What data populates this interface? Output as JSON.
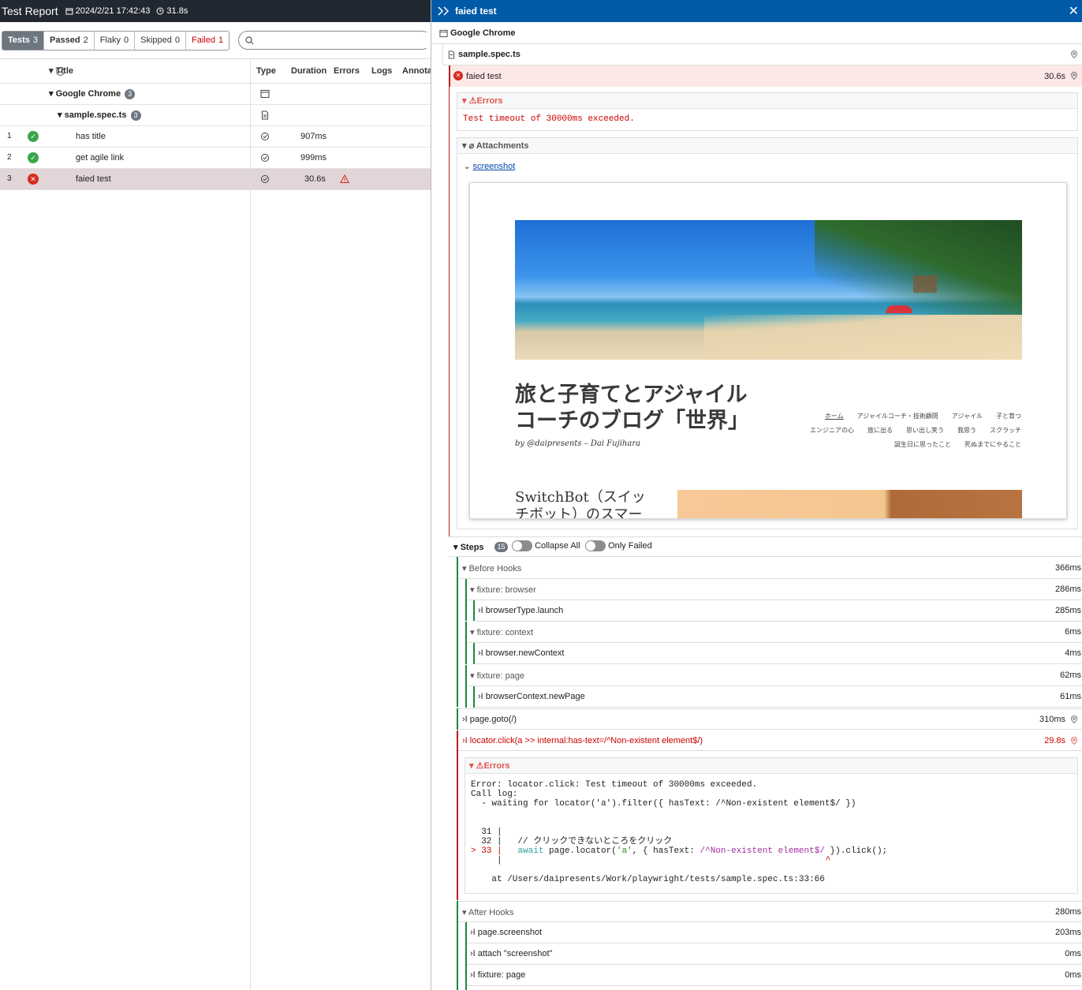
{
  "app": {
    "title": "Test Report",
    "date": "2024/2/21 17:42:43",
    "duration": "31.8s"
  },
  "filters": [
    {
      "label": "Tests",
      "count": "3"
    },
    {
      "label": "Passed",
      "count": "2"
    },
    {
      "label": "Flaky",
      "count": "0"
    },
    {
      "label": "Skipped",
      "count": "0"
    },
    {
      "label": "Failed",
      "count": "1"
    }
  ],
  "search": {
    "placeholder": ""
  },
  "table": {
    "headers": {
      "title": "Title",
      "type": "Type",
      "duration": "Duration",
      "errors": "Errors",
      "logs": "Logs",
      "annotations": "Annota"
    },
    "project": {
      "name": "Google Chrome",
      "count": "3"
    },
    "file": {
      "name": "sample.spec.ts",
      "count": "3"
    },
    "rows": [
      {
        "num": "1",
        "title": "has title",
        "duration": "907ms"
      },
      {
        "num": "2",
        "title": "get agile link",
        "duration": "999ms"
      },
      {
        "num": "3",
        "title": "faied test",
        "duration": "30.6s"
      }
    ]
  },
  "detail": {
    "title": "faied test",
    "project": "Google Chrome",
    "file": "sample.spec.ts",
    "test": {
      "name": "faied test",
      "duration": "30.6s"
    },
    "errors_label": "Errors",
    "error_message": "Test timeout of 30000ms exceeded.",
    "attachments_label": "Attachments",
    "screenshot_label": "screenshot",
    "screenshot": {
      "blog_title_1": "旅と子育てとアジャイル",
      "blog_title_2": "コーチのブログ「世界」",
      "byline": "by @daipresents – Dai Fujihara",
      "nav_row1": [
        "ホーム",
        "アジャイルコーチ・技術顧問",
        "アジャイル",
        "子と育つ"
      ],
      "nav_row2": [
        "エンジニアの心",
        "旅に出る",
        "思い出し笑う",
        "我思う",
        "スクラッチ"
      ],
      "nav_row3": [
        "誕生日に思ったこと",
        "死ぬまでにやること"
      ],
      "post_title_1": "SwitchBot（スイッ",
      "post_title_2": "チボット）のスマー"
    },
    "steps_label": "Steps",
    "steps_count": "15",
    "collapse_all": "Collapse All",
    "only_failed": "Only Failed",
    "steps": [
      {
        "label": "Before Hooks",
        "duration": "366ms"
      },
      {
        "label": "fixture: browser",
        "duration": "286ms"
      },
      {
        "label": "browserType.launch",
        "duration": "285ms"
      },
      {
        "label": "fixture: context",
        "duration": "6ms"
      },
      {
        "label": "browser.newContext",
        "duration": "4ms"
      },
      {
        "label": "fixture: page",
        "duration": "62ms"
      },
      {
        "label": "browserContext.newPage",
        "duration": "61ms"
      },
      {
        "label": "page.goto(/)",
        "duration": "310ms"
      },
      {
        "label": "locator.click(a >> internal:has-text=/^Non-existent element$/)",
        "duration": "29.8s"
      },
      {
        "label": "After Hooks",
        "duration": "280ms"
      },
      {
        "label": "page.screenshot",
        "duration": "203ms"
      },
      {
        "label": "attach \"screenshot\"",
        "duration": "0ms"
      },
      {
        "label": "fixture: page",
        "duration": "0ms"
      }
    ],
    "step_error": {
      "label": "Errors",
      "line1": "Error: locator.click: Test timeout of 30000ms exceeded.",
      "line2": "Call log:",
      "line3": "  - waiting for locator('a').filter({ hasText: /^Non-existent element$/ })",
      "code1": "  31 |",
      "code2": "  32 |   // クリックできないところをクリック",
      "code3_prefix": "> 33 |   ",
      "code3_kw": "await",
      "code3_a": " page.locator(",
      "code3_str": "'a'",
      "code3_b": ", { hasText: ",
      "code3_re": "/^Non-existent element$/",
      "code3_c": " }).click();",
      "code4": "     |",
      "caret": "^",
      "at": "    at /Users/daipresents/Work/playwright/tests/sample.spec.ts:33:66"
    }
  }
}
